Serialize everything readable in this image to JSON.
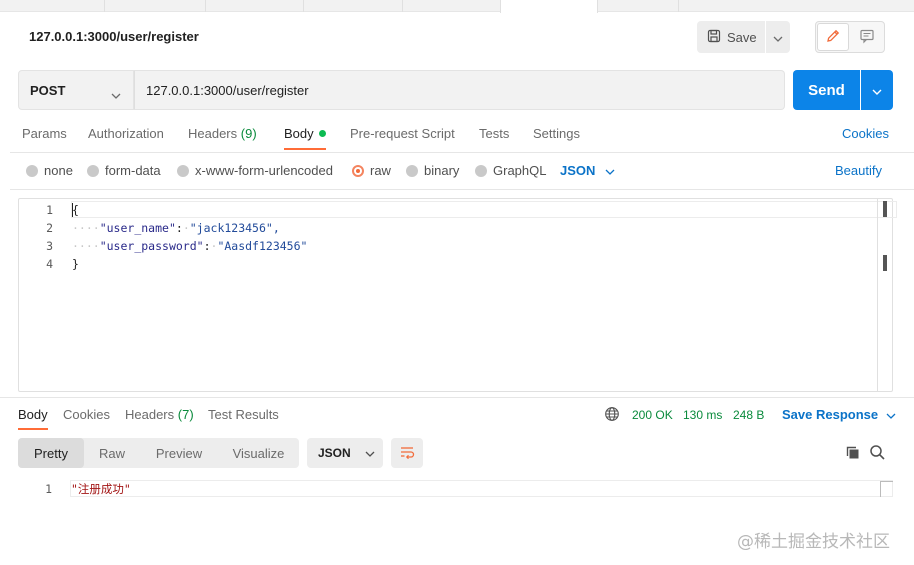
{
  "request": {
    "title": "127.0.0.1:3000/user/register",
    "save_label": "Save",
    "method": "POST",
    "url": "127.0.0.1:3000/user/register",
    "send_label": "Send"
  },
  "request_tabs": {
    "params": "Params",
    "authorization": "Authorization",
    "headers": "Headers",
    "headers_count": "(9)",
    "body": "Body",
    "pre_request": "Pre-request Script",
    "tests": "Tests",
    "settings": "Settings",
    "cookies": "Cookies"
  },
  "body_types": {
    "none": "none",
    "form_data": "form-data",
    "urlencoded": "x-www-form-urlencoded",
    "raw": "raw",
    "binary": "binary",
    "graphql": "GraphQL",
    "selected": "raw",
    "language": "JSON",
    "beautify": "Beautify"
  },
  "editor": {
    "lines": [
      {
        "num": "1",
        "text": "{"
      },
      {
        "num": "2",
        "key": "\"user_name\"",
        "value": "\"jack123456\","
      },
      {
        "num": "3",
        "key": "\"user_password\"",
        "value": "\"Aasdf123456\""
      },
      {
        "num": "4",
        "text": "}"
      }
    ]
  },
  "response_tabs": {
    "body": "Body",
    "cookies": "Cookies",
    "headers": "Headers",
    "headers_count": "(7)",
    "test_results": "Test Results"
  },
  "response_meta": {
    "status": "200 OK",
    "time": "130 ms",
    "size": "248 B",
    "save_response": "Save Response"
  },
  "response_view": {
    "pretty": "Pretty",
    "raw": "Raw",
    "preview": "Preview",
    "visualize": "Visualize",
    "language": "JSON",
    "line_num": "1",
    "body": "\"注册成功\""
  },
  "watermark": "@稀土掘金技术社区",
  "colors": {
    "accent_orange": "#ff6c37",
    "send_blue": "#0c84e8",
    "link_blue": "#0b73c8",
    "success_green": "#0a8a3c"
  }
}
